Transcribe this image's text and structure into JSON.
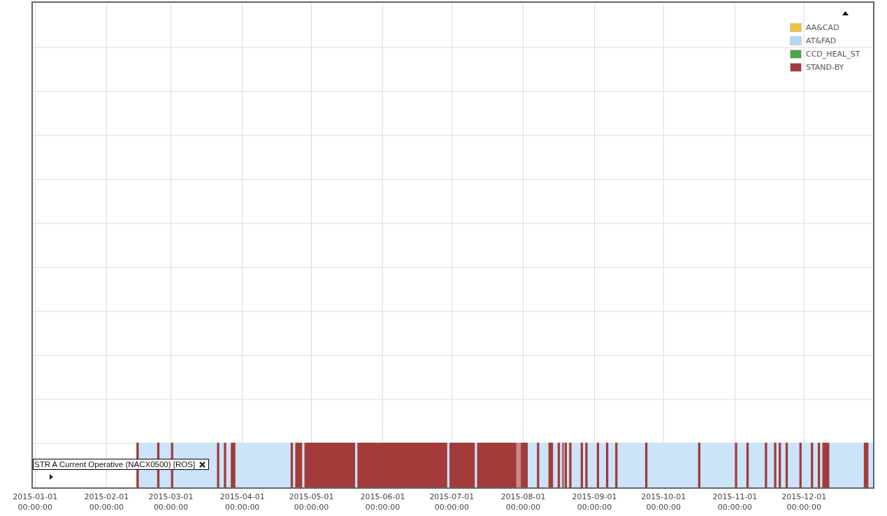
{
  "legend": {
    "collapsed": false,
    "items": [
      {
        "label": "AA&CAD",
        "color": "#f0c23c"
      },
      {
        "label": "AT&FAD",
        "color": "#b1d8f8"
      },
      {
        "label": "CCD_HEAL_ST",
        "color": "#4ba64b"
      },
      {
        "label": "STAND-BY",
        "color": "#a33b3b"
      }
    ]
  },
  "timeline": {
    "series_label": "STR A Current Operative (NACX0500) [ROS]",
    "x_axis": [
      {
        "date": "2015-01-01",
        "time": "00:00:00"
      },
      {
        "date": "2015-02-01",
        "time": "00:00:00"
      },
      {
        "date": "2015-03-01",
        "time": "00:00:00"
      },
      {
        "date": "2015-04-01",
        "time": "00:00:00"
      },
      {
        "date": "2015-05-01",
        "time": "00:00:00"
      },
      {
        "date": "2015-06-01",
        "time": "00:00:00"
      },
      {
        "date": "2015-07-01",
        "time": "00:00:00"
      },
      {
        "date": "2015-08-01",
        "time": "00:00:00"
      },
      {
        "date": "2015-09-01",
        "time": "00:00:00"
      },
      {
        "date": "2015-10-01",
        "time": "00:00:00"
      },
      {
        "date": "2015-11-01",
        "time": "00:00:00"
      },
      {
        "date": "2015-12-01",
        "time": "00:00:00"
      }
    ]
  }
}
